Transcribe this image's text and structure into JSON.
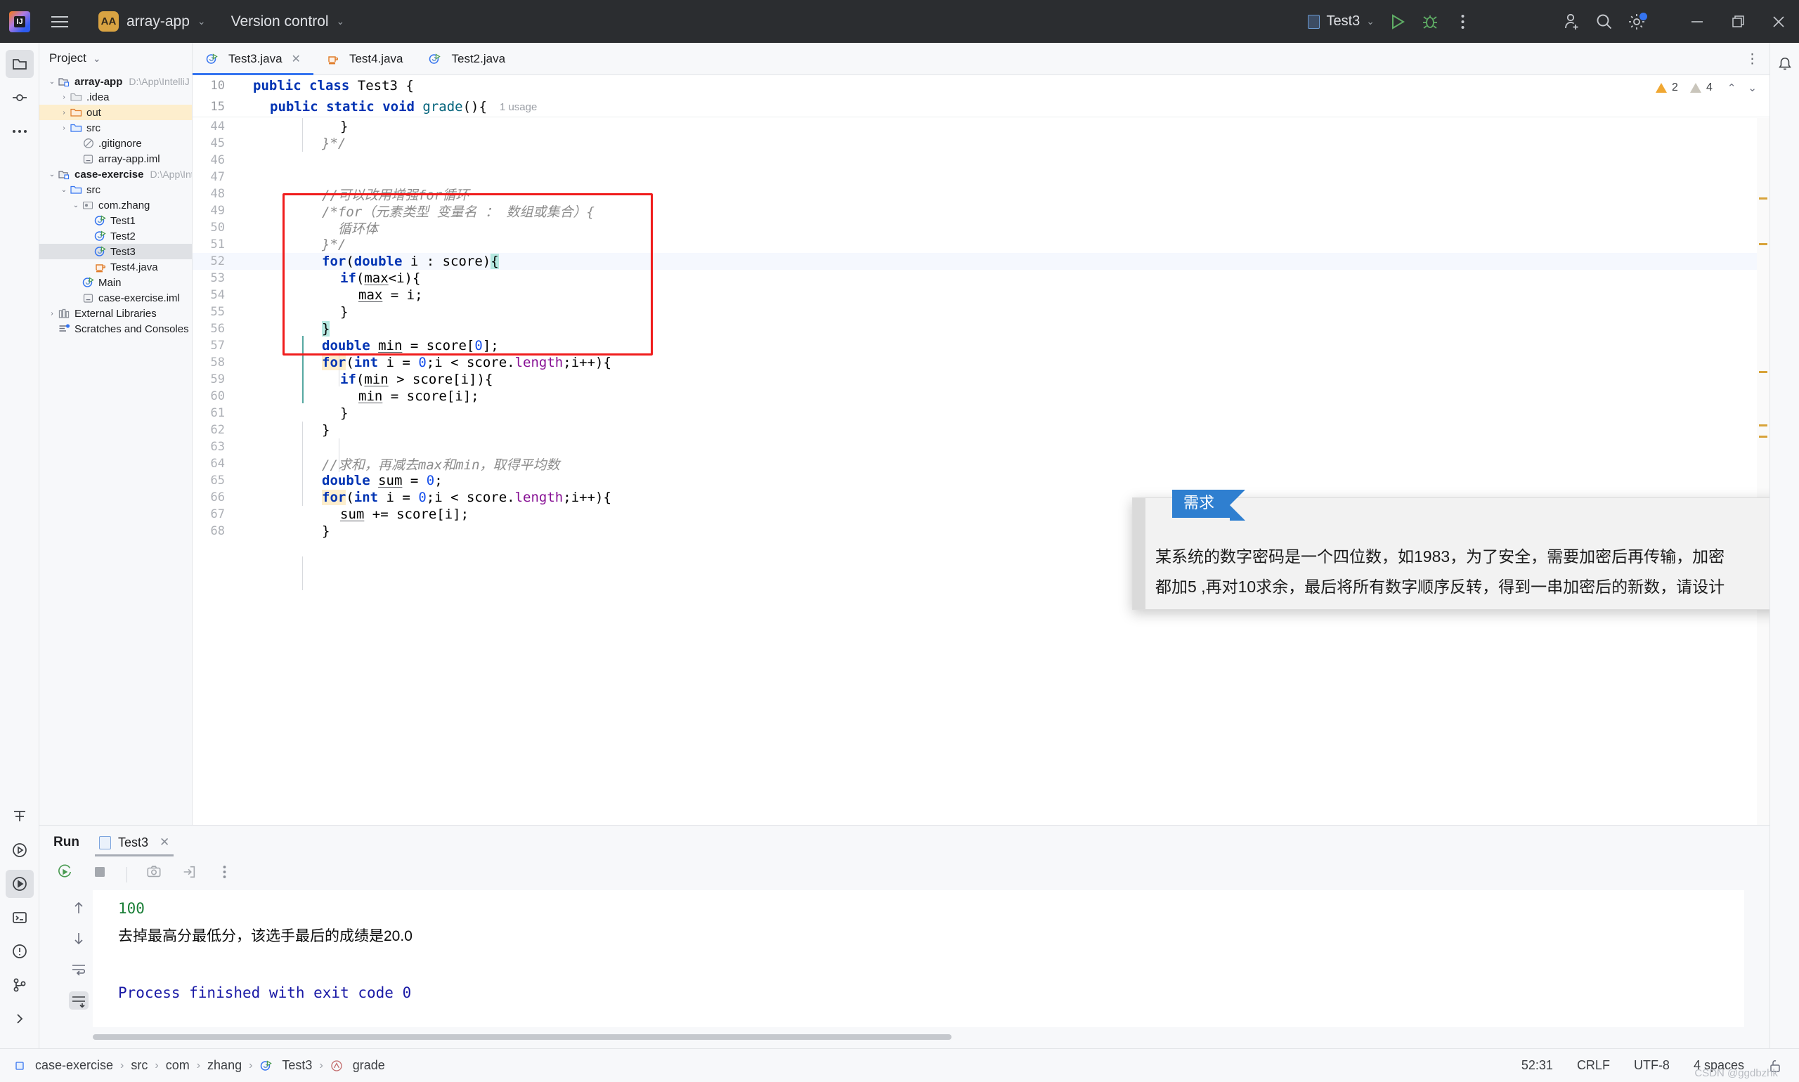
{
  "titlebar": {
    "logo_icon": "intellij-logo-icon",
    "menu_icon": "hamburger-menu-icon",
    "project_badge": "AA",
    "project_name": "array-app",
    "vcs_label": "Version control",
    "run_config": "Test3",
    "run_icon": "run-play-icon",
    "debug_icon": "debug-bug-icon",
    "more_icon": "more-vertical-icon",
    "account_icon": "add-user-icon",
    "search_icon": "search-icon",
    "settings_icon": "gear-icon",
    "minimize_icon": "minimize-icon",
    "maximize_icon": "maximize-icon",
    "close_icon": "close-icon"
  },
  "left_rail": {
    "items": [
      {
        "name": "project-tool-icon",
        "glyph": "folder"
      },
      {
        "name": "commit-tool-icon",
        "glyph": "commit"
      },
      {
        "name": "more-tool-icon",
        "glyph": "dots"
      }
    ],
    "bottom_items": [
      {
        "name": "structure-tool-icon",
        "glyph": "structure"
      },
      {
        "name": "services-tool-icon",
        "glyph": "play-circle"
      },
      {
        "name": "run-tool-icon",
        "glyph": "run-circle"
      },
      {
        "name": "terminal-tool-icon",
        "glyph": "terminal"
      },
      {
        "name": "problems-tool-icon",
        "glyph": "warning-circle"
      },
      {
        "name": "git-tool-icon",
        "glyph": "git"
      },
      {
        "name": "expand-rail-icon",
        "glyph": "chevron-right"
      }
    ]
  },
  "project_panel": {
    "title": "Project",
    "chevron_icon": "chevron-down-icon",
    "tree": [
      {
        "depth": 0,
        "arrow": "down",
        "icon": "module-icon",
        "label": "array-app",
        "bold": true,
        "path": "D:\\App\\IntelliJ IDEA C",
        "state": "normal"
      },
      {
        "depth": 1,
        "arrow": "right",
        "icon": "folder-grey-icon",
        "label": ".idea",
        "bold": false,
        "path": "",
        "state": "normal"
      },
      {
        "depth": 1,
        "arrow": "right",
        "icon": "folder-orange-icon",
        "label": "out",
        "bold": false,
        "path": "",
        "state": "highlight"
      },
      {
        "depth": 1,
        "arrow": "right",
        "icon": "folder-blue-icon",
        "label": "src",
        "bold": false,
        "path": "",
        "state": "normal"
      },
      {
        "depth": 2,
        "arrow": "none",
        "icon": "gitignore-icon",
        "label": ".gitignore",
        "bold": false,
        "path": "",
        "state": "normal"
      },
      {
        "depth": 2,
        "arrow": "none",
        "icon": "iml-file-icon",
        "label": "array-app.iml",
        "bold": false,
        "path": "",
        "state": "normal"
      },
      {
        "depth": 0,
        "arrow": "down",
        "icon": "module-icon",
        "label": "case-exercise",
        "bold": true,
        "path": "D:\\App\\IntelliJ IDE",
        "state": "normal"
      },
      {
        "depth": 1,
        "arrow": "down",
        "icon": "folder-blue-icon",
        "label": "src",
        "bold": false,
        "path": "",
        "state": "normal"
      },
      {
        "depth": 2,
        "arrow": "down",
        "icon": "package-icon",
        "label": "com.zhang",
        "bold": false,
        "path": "",
        "state": "normal"
      },
      {
        "depth": 3,
        "arrow": "none",
        "icon": "java-runnable-class-icon",
        "label": "Test1",
        "bold": false,
        "path": "",
        "state": "normal"
      },
      {
        "depth": 3,
        "arrow": "none",
        "icon": "java-runnable-class-icon",
        "label": "Test2",
        "bold": false,
        "path": "",
        "state": "normal"
      },
      {
        "depth": 3,
        "arrow": "none",
        "icon": "java-runnable-class-icon",
        "label": "Test3",
        "bold": false,
        "path": "",
        "state": "selected"
      },
      {
        "depth": 3,
        "arrow": "none",
        "icon": "java-file-icon",
        "label": "Test4.java",
        "bold": false,
        "path": "",
        "state": "normal"
      },
      {
        "depth": 2,
        "arrow": "none",
        "icon": "java-runnable-class-icon",
        "label": "Main",
        "bold": false,
        "path": "",
        "state": "normal"
      },
      {
        "depth": 2,
        "arrow": "none",
        "icon": "iml-file-icon",
        "label": "case-exercise.iml",
        "bold": false,
        "path": "",
        "state": "normal"
      },
      {
        "depth": 0,
        "arrow": "right",
        "icon": "libraries-icon",
        "label": "External Libraries",
        "bold": false,
        "path": "",
        "state": "normal"
      },
      {
        "depth": 0,
        "arrow": "none",
        "icon": "scratches-icon",
        "label": "Scratches and Consoles",
        "bold": false,
        "path": "",
        "state": "normal"
      }
    ]
  },
  "editor": {
    "tabs": [
      {
        "label": "Test3.java",
        "icon": "java-runnable-class-icon",
        "active": true,
        "closable": true
      },
      {
        "label": "Test4.java",
        "icon": "java-file-icon",
        "active": false,
        "closable": false
      },
      {
        "label": "Test2.java",
        "icon": "java-runnable-class-icon",
        "active": false,
        "closable": false
      }
    ],
    "tab_options_icon": "more-vertical-icon",
    "sticky_lines": [
      {
        "num": "10",
        "text": "public class Test3 {"
      },
      {
        "num": "15",
        "text": "public static void grade(){",
        "hint": "1 usage"
      }
    ],
    "inspections": {
      "warning_count": "2",
      "weak_warning_count": "4",
      "up_icon": "chevron-up-icon",
      "down_icon": "chevron-down-icon"
    },
    "lines": [
      {
        "num": "44",
        "indent": 3,
        "text": "}"
      },
      {
        "num": "45",
        "indent": 2,
        "text": "}*/"
      },
      {
        "num": "46",
        "indent": 0,
        "text": ""
      },
      {
        "num": "47",
        "indent": 0,
        "text": ""
      },
      {
        "num": "48",
        "indent": 2,
        "text": "//可以改用增强for循环"
      },
      {
        "num": "49",
        "indent": 2,
        "text": "/*for（元素类型 变量名 ： 数组或集合）{"
      },
      {
        "num": "50",
        "indent": 2,
        "text": "  循环体"
      },
      {
        "num": "51",
        "indent": 2,
        "text": "}*/"
      },
      {
        "num": "52",
        "indent": 2,
        "text": "for(double i : score){"
      },
      {
        "num": "53",
        "indent": 3,
        "text": "if(max<i){"
      },
      {
        "num": "54",
        "indent": 4,
        "text": "max = i;"
      },
      {
        "num": "55",
        "indent": 3,
        "text": "}"
      },
      {
        "num": "56",
        "indent": 2,
        "text": "}"
      },
      {
        "num": "57",
        "indent": 2,
        "text": "double min = score[0];"
      },
      {
        "num": "58",
        "indent": 2,
        "text": "for(int i = 0;i < score.length;i++){"
      },
      {
        "num": "59",
        "indent": 3,
        "text": "if(min > score[i]){"
      },
      {
        "num": "60",
        "indent": 4,
        "text": "min = score[i];"
      },
      {
        "num": "61",
        "indent": 3,
        "text": "}"
      },
      {
        "num": "62",
        "indent": 2,
        "text": "}"
      },
      {
        "num": "63",
        "indent": 0,
        "text": ""
      },
      {
        "num": "64",
        "indent": 2,
        "text": "//求和，再减去max和min，取得平均数"
      },
      {
        "num": "65",
        "indent": 2,
        "text": "double sum = 0;"
      },
      {
        "num": "66",
        "indent": 2,
        "text": "for(int i = 0;i < score.length;i++){"
      },
      {
        "num": "67",
        "indent": 3,
        "text": "sum += score[i];"
      },
      {
        "num": "68",
        "indent": 2,
        "text": "}"
      }
    ]
  },
  "popup": {
    "tag": "需求",
    "line1": "某系统的数字密码是一个四位数，如1983，为了安全，需要加密后再传输，加密",
    "line2": "都加5 ,再对10求余，最后将所有数字顺序反转，得到一串加密后的新数，请设计"
  },
  "run_panel": {
    "title": "Run",
    "tab_label": "Test3",
    "tab_icon": "console-icon",
    "tab_close_icon": "close-icon",
    "toolbar": [
      {
        "name": "rerun-icon"
      },
      {
        "name": "stop-icon"
      },
      {
        "name": "screenshot-icon"
      },
      {
        "name": "export-icon"
      },
      {
        "name": "more-vertical-icon"
      }
    ],
    "gutter": [
      {
        "name": "scroll-up-icon"
      },
      {
        "name": "scroll-down-icon"
      },
      {
        "name": "soft-wrap-icon"
      },
      {
        "name": "scroll-to-end-icon"
      }
    ],
    "console": [
      {
        "text": "100",
        "style": "green"
      },
      {
        "text": "去掉最高分最低分，该选手最后的成绩是20.0",
        "style": "black"
      },
      {
        "text": "",
        "style": "black"
      },
      {
        "text": "Process finished with exit code 0",
        "style": "blue"
      }
    ]
  },
  "status_bar": {
    "breadcrumb": [
      {
        "label": "case-exercise",
        "icon": "module-small-icon"
      },
      {
        "label": "src",
        "icon": ""
      },
      {
        "label": "com",
        "icon": ""
      },
      {
        "label": "zhang",
        "icon": ""
      },
      {
        "label": "Test3",
        "icon": "java-runnable-class-icon"
      },
      {
        "label": "grade",
        "icon": "method-icon"
      }
    ],
    "caret_position": "52:31",
    "line_separator": "CRLF",
    "encoding": "UTF-8",
    "indent": "4 spaces",
    "lock_icon": "lock-open-icon",
    "watermark": "CSDN @ggdbzhk"
  }
}
